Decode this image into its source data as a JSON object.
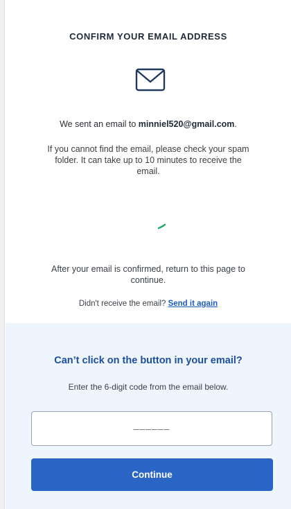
{
  "header": {
    "title": "CONFIRM YOUR EMAIL ADDRESS"
  },
  "icons": {
    "mail": "envelope-icon",
    "spinner": "loading-spinner"
  },
  "message": {
    "sent_prefix": "We sent an email to ",
    "email": "minniel520@gmail.com",
    "sent_suffix": ".",
    "spam_info": "If you cannot find the email, please check your spam folder. It can take up to 10 minutes to receive the email.",
    "after_confirm": "After your email is confirmed, return to this page to continue.",
    "resend_prompt": "Didn't receive the email? ",
    "resend_link": "Send it again"
  },
  "code_section": {
    "heading": "Can’t click on the button in your email?",
    "instruction": "Enter the 6-digit code from the email below.",
    "input_value": "",
    "input_placeholder": "––––––",
    "continue_label": "Continue"
  },
  "colors": {
    "primary": "#2a64c5",
    "link": "#1d5bbf",
    "heading_blue": "#1d4e9e",
    "panel_bg": "#eef5fd",
    "spinner": "#22a86b",
    "icon": "#1f3a5c"
  }
}
